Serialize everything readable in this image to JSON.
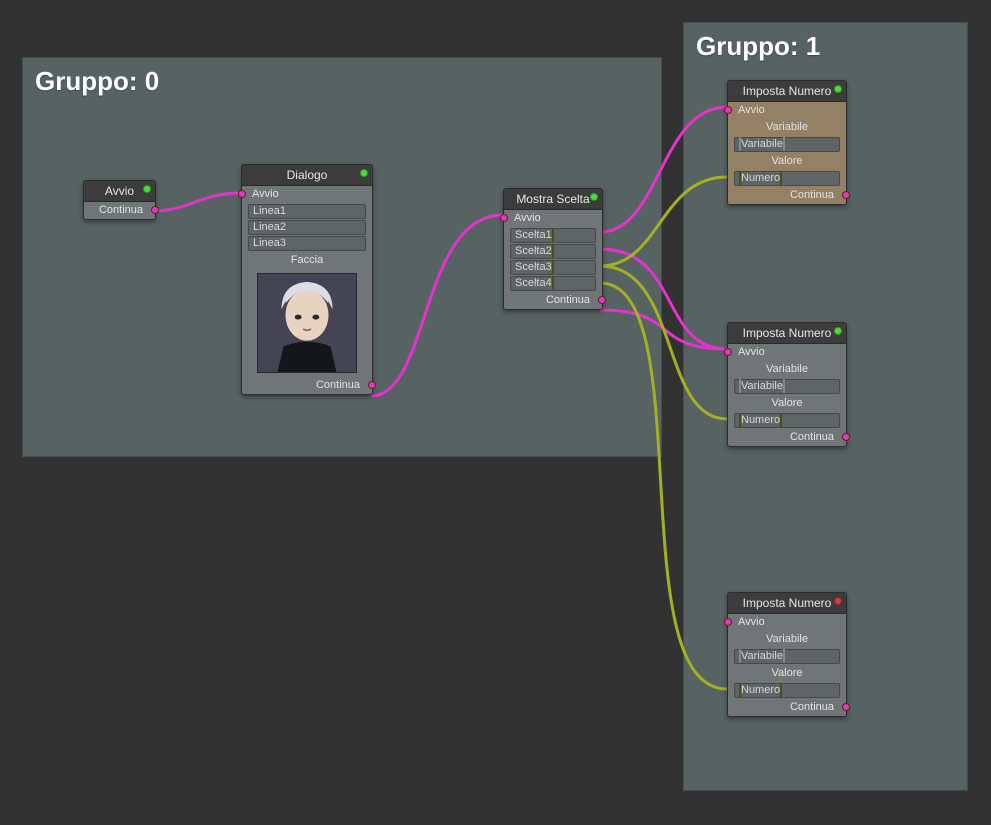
{
  "groups": {
    "g0": {
      "label": "Gruppo: 0"
    },
    "g1": {
      "label": "Gruppo: 1"
    }
  },
  "nodes": {
    "avvio": {
      "title": "Avvio",
      "out": "Continua"
    },
    "dialogo": {
      "title": "Dialogo",
      "in": "Avvio",
      "lines": [
        "Linea1",
        "Linea2",
        "Linea3"
      ],
      "face_label": "Faccia",
      "out": "Continua"
    },
    "scelta": {
      "title": "Mostra Scelta",
      "in": "Avvio",
      "choices": [
        "Scelta1",
        "Scelta2",
        "Scelta3",
        "Scelta4"
      ],
      "out": "Continua"
    },
    "imp1": {
      "title": "Imposta Numero",
      "in": "Avvio",
      "var_label": "Variabile",
      "var_field": "Variabile",
      "val_label": "Valore",
      "val_field": "Numero",
      "out": "Continua"
    },
    "imp2": {
      "title": "Imposta Numero",
      "in": "Avvio",
      "var_label": "Variabile",
      "var_field": "Variabile",
      "val_label": "Valore",
      "val_field": "Numero",
      "out": "Continua"
    },
    "imp3": {
      "title": "Imposta Numero",
      "in": "Avvio",
      "var_label": "Variabile",
      "var_field": "Variabile",
      "val_label": "Valore",
      "val_field": "Numero",
      "out": "Continua"
    }
  }
}
